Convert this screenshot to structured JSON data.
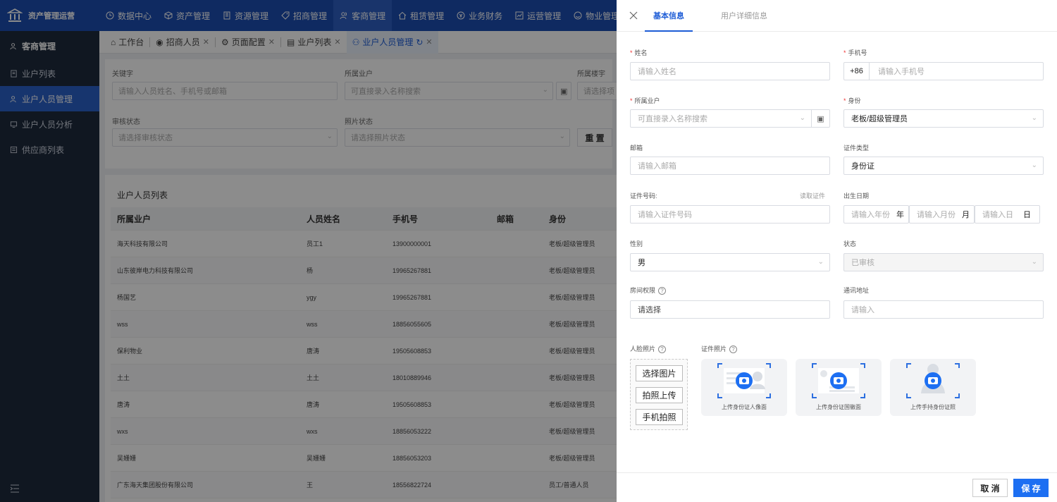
{
  "app": {
    "title": "资产管理运营"
  },
  "topnav": [
    {
      "label": "数据中心",
      "icon": "clock-icon"
    },
    {
      "label": "资产管理",
      "icon": "cube-icon"
    },
    {
      "label": "资源管理",
      "icon": "building-icon"
    },
    {
      "label": "招商管理",
      "icon": "tag-icon"
    },
    {
      "label": "客商管理",
      "icon": "users-icon"
    },
    {
      "label": "租赁管理",
      "icon": "home-icon"
    },
    {
      "label": "业务财务",
      "icon": "money-icon"
    },
    {
      "label": "运营管理",
      "icon": "chart-icon"
    },
    {
      "label": "物业管理",
      "icon": "smile-icon"
    }
  ],
  "sidebar": {
    "header": "客商管理",
    "items": [
      {
        "label": "业户列表"
      },
      {
        "label": "业户人员管理"
      },
      {
        "label": "业户人员分析"
      },
      {
        "label": "供应商列表"
      }
    ]
  },
  "tabs": [
    {
      "label": "工作台"
    },
    {
      "label": "招商人员"
    },
    {
      "label": "页面配置"
    },
    {
      "label": "业户列表"
    },
    {
      "label": "业户人员管理"
    }
  ],
  "filter": {
    "keyword_label": "关键字",
    "keyword_placeholder": "请输入人员姓名、手机号或邮箱",
    "tenant_label": "所属业户",
    "tenant_placeholder": "可直接录入名称搜索",
    "building_label": "所属楼宇",
    "building_placeholder": "请选择项",
    "audit_label": "审核状态",
    "audit_placeholder": "请选择审核状态",
    "photo_label": "照片状态",
    "photo_placeholder": "请选择照片状态",
    "reset": "重 置"
  },
  "list": {
    "title": "业户人员列表",
    "columns": [
      "所属业户",
      "人员姓名",
      "手机号",
      "邮箱",
      "身份"
    ],
    "rows": [
      [
        "海天科技有限公司",
        "员工1",
        "13900000001",
        "",
        "老板/超级管理员"
      ],
      [
        "山东彼岸电力科技有限公司",
        "杨",
        "19965267881",
        "",
        "老板/超级管理员"
      ],
      [
        "杨国艺",
        "ygy",
        "19965267881",
        "",
        "老板/超级管理员"
      ],
      [
        "wss",
        "wss",
        "18856055605",
        "",
        "老板/超级管理员"
      ],
      [
        "保利物业",
        "唐涛",
        "19505608853",
        "",
        "老板/超级管理员"
      ],
      [
        "土土",
        "土土",
        "18010889946",
        "",
        "老板/超级管理员"
      ],
      [
        "唐涛",
        "唐涛",
        "19505608853",
        "",
        "老板/超级管理员"
      ],
      [
        "wxs",
        "wxs",
        "18856053222",
        "",
        "老板/超级管理员"
      ],
      [
        "吴姗姗",
        "吴姗姗",
        "18856053203",
        "",
        "老板/超级管理员"
      ],
      [
        "广东海天集团股份有限公司",
        "王",
        "18556822724",
        "",
        "员工/普通人员"
      ]
    ]
  },
  "drawer": {
    "tabs": [
      "基本信息",
      "用户详细信息"
    ],
    "name_label": "姓名",
    "name_placeholder": "请输入姓名",
    "phone_label": "手机号",
    "phone_prefix": "+86",
    "phone_placeholder": "请输入手机号",
    "tenant_label": "所属业户",
    "tenant_placeholder": "可直接录入名称搜索",
    "identity_label": "身份",
    "identity_value": "老板/超级管理员",
    "email_label": "邮箱",
    "email_placeholder": "请输入邮箱",
    "idtype_label": "证件类型",
    "idtype_value": "身份证",
    "idno_label": "证件号码:",
    "read_id": "读取证件",
    "idno_placeholder": "请输入证件号码",
    "birth_label": "出生日期",
    "year_placeholder": "请输入年份",
    "year_unit": "年",
    "month_placeholder": "请输入月份",
    "month_unit": "月",
    "day_placeholder": "请输入日",
    "day_unit": "日",
    "gender_label": "性别",
    "gender_value": "男",
    "status_label": "状态",
    "status_value": "已审核",
    "room_label": "房间权限",
    "room_placeholder": "请选择",
    "address_label": "通讯地址",
    "address_placeholder": "请输入",
    "face_label": "人脸照片",
    "idphoto_label": "证件照片",
    "face_buttons": [
      "选择图片",
      "拍照上传",
      "手机拍照"
    ],
    "id_cards": [
      "上传身份证人像面",
      "上传身份证国徽面",
      "上传手持身份证照"
    ],
    "cancel": "取 消",
    "save": "保 存"
  },
  "colors": {
    "primary": "#1d4db1",
    "accent": "#1d6ff2",
    "sidebar": "#1e2a3c",
    "required": "#e33"
  }
}
